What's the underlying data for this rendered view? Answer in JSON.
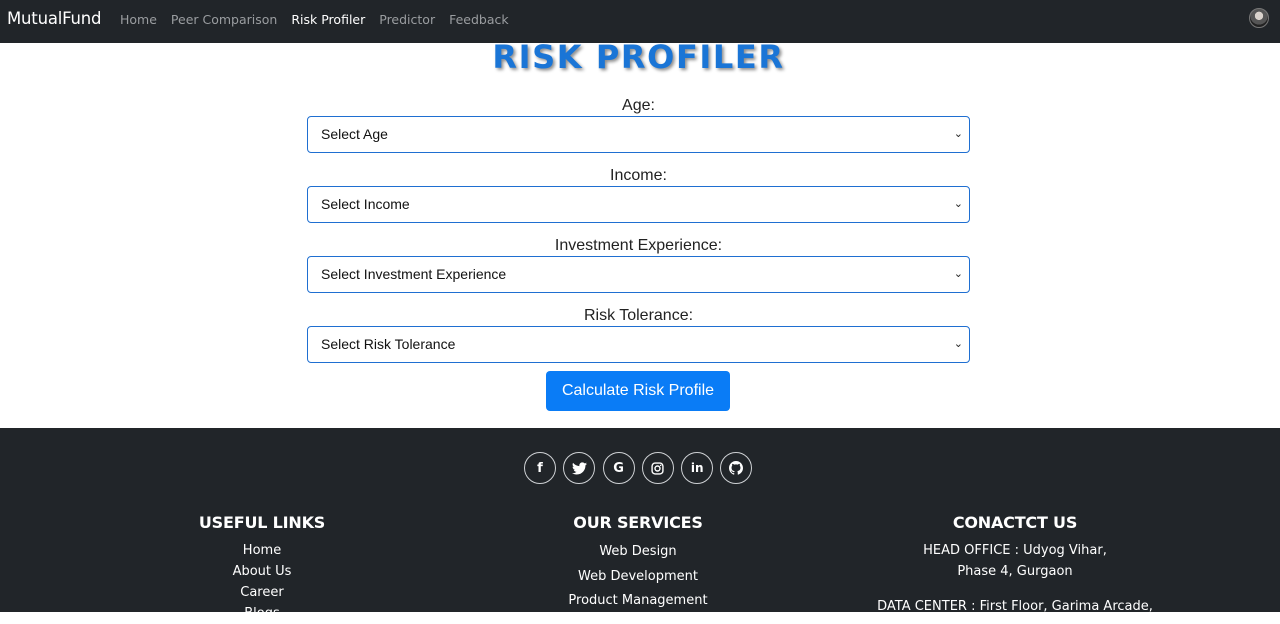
{
  "navbar": {
    "brand": "MutualFund",
    "links": [
      "Home",
      "Peer Comparison",
      "Risk Profiler",
      "Predictor",
      "Feedback"
    ],
    "active_index": 2
  },
  "page": {
    "title": "RISK PROFILER",
    "fields": [
      {
        "label": "Age:",
        "placeholder": "Select Age"
      },
      {
        "label": "Income:",
        "placeholder": "Select Income"
      },
      {
        "label": "Investment Experience:",
        "placeholder": "Select Investment Experience"
      },
      {
        "label": "Risk Tolerance:",
        "placeholder": "Select Risk Tolerance"
      }
    ],
    "submit_label": "Calculate Risk Profile"
  },
  "footer": {
    "socials": [
      "facebook-icon",
      "twitter-icon",
      "google-icon",
      "instagram-icon",
      "linkedin-icon",
      "github-icon"
    ],
    "useful_links": {
      "heading": "USEFUL LINKS",
      "items": [
        "Home",
        "About Us",
        "Career",
        "Blogs"
      ]
    },
    "services": {
      "heading": "OUR SERVICES",
      "items": [
        "Web Design",
        "Web Development",
        "Product Management"
      ]
    },
    "contact": {
      "heading": "CONACTCT US",
      "head_office_line1": "HEAD OFFICE : Udyog Vihar,",
      "head_office_line2": "Phase 4, Gurgaon",
      "data_center": "DATA CENTER : First Floor, Garima Arcade,"
    }
  },
  "colors": {
    "navbar_bg": "#212529",
    "title_blue": "#1a75d6",
    "select_border": "#1f6fd1",
    "button_bg": "#0a7cf6"
  }
}
